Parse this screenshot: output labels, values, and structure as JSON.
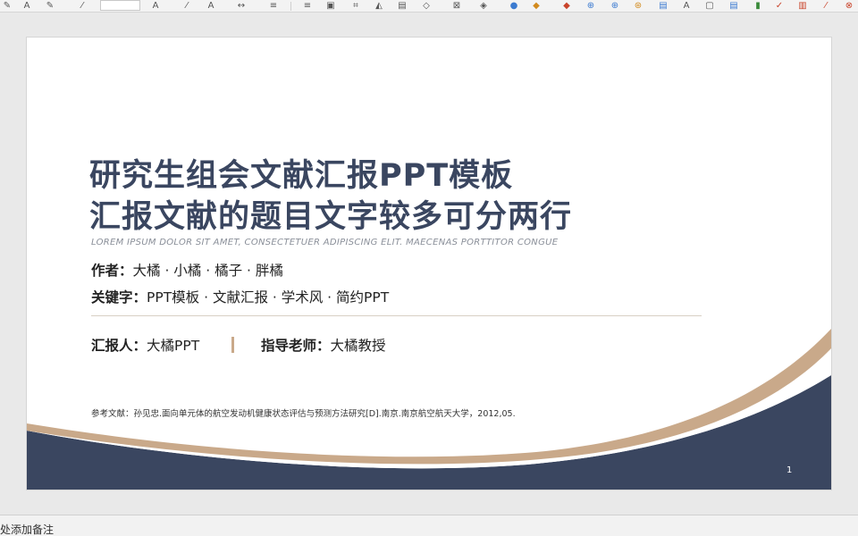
{
  "toolbar": {
    "icons": [
      "pen-icon",
      "text-box-icon",
      "edit-icon",
      "eyedropper-icon",
      "font-color-icon",
      "highlight-icon",
      "char-color-icon",
      "char-spacing-icon",
      "list-icon",
      "align-icon",
      "image-icon",
      "crop-icon",
      "shape-icon",
      "transform-icon",
      "fill-icon",
      "table-icon",
      "chart-icon",
      "dot-icon",
      "link-icon",
      "media-icon",
      "symbol-icon",
      "special-icon",
      "check-icon",
      "bars-icon"
    ]
  },
  "slide": {
    "title_line1": "研究生组会文献汇报PPT模板",
    "title_line2": "汇报文献的题目文字较多可分两行",
    "lorem": "LOREM IPSUM DOLOR SIT AMET, CONSECTETUER ADIPISCING ELIT. MAECENAS PORTTITOR CONGUE",
    "authors_label": "作者：",
    "authors_value": "大橘 · 小橘 · 橘子 · 胖橘",
    "keywords_label": "关键字：",
    "keywords_value": "PPT模板 · 文献汇报 · 学术风 · 简约PPT",
    "reporter_label": "汇报人：",
    "reporter_value": "大橘PPT",
    "advisor_label": "指导老师：",
    "advisor_value": "大橘教授",
    "reference": "参考文献：孙见忠.面向单元体的航空发动机健康状态评估与预测方法研究[D].南京.南京航空航天大学，2012,05.",
    "page_number": "1"
  },
  "notes": {
    "placeholder": "处添加备注"
  },
  "colors": {
    "navy": "#3a4660",
    "tan": "#c9a98a",
    "divider": "#d8d0c4"
  }
}
